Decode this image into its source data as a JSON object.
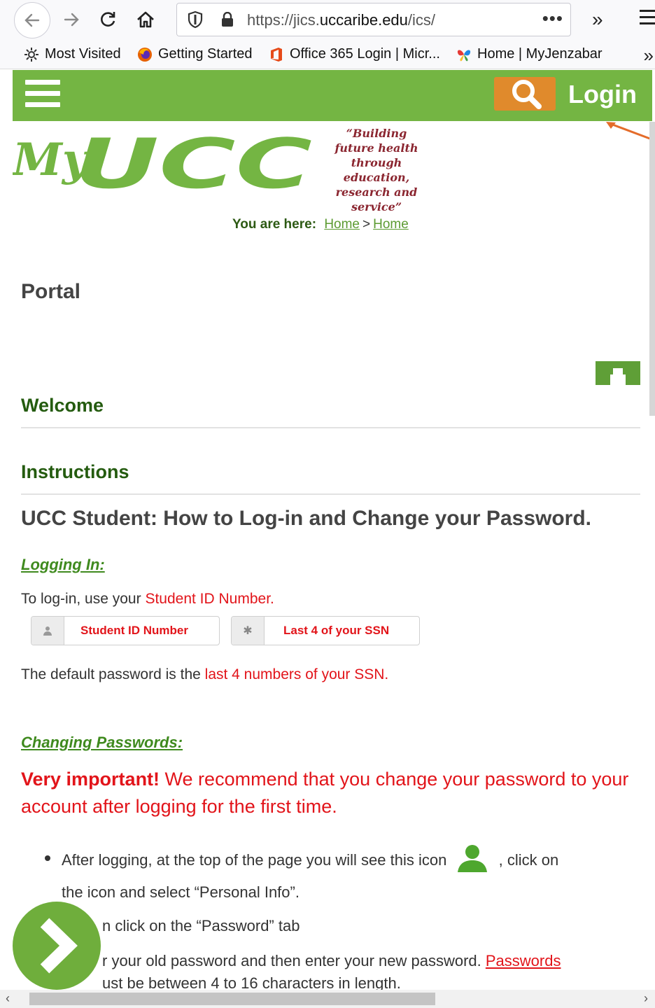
{
  "browser": {
    "url_prefix": "https://jics.",
    "url_domain": "uccaribe.edu",
    "url_suffix": "/ics/",
    "more_label": "•••",
    "overflow_label": "»"
  },
  "bookmarks": [
    {
      "label": "Most Visited",
      "icon": "gear-icon"
    },
    {
      "label": "Getting Started",
      "icon": "firefox-icon"
    },
    {
      "label": "Office 365 Login | Micr...",
      "icon": "office-icon"
    },
    {
      "label": "Home | MyJenzabar",
      "icon": "butterfly-icon"
    }
  ],
  "header": {
    "login_label": "Login",
    "colors": {
      "header_green": "#74b543",
      "search_orange": "#e08a2c"
    }
  },
  "logo": {
    "tagline": "“Building future health through education, research and service”"
  },
  "breadcrumb": {
    "prefix": "You are here:",
    "items": [
      "Home",
      "Home"
    ],
    "separator": ">"
  },
  "page": {
    "portal_title": "Portal",
    "welcome": "Welcome",
    "instructions": "Instructions",
    "heading": "UCC Student: How to Log-in and Change your Password."
  },
  "logging_in": {
    "subhead": "Logging In:",
    "intro": "To log-in, use your ",
    "intro_red": "Student ID Number.",
    "field_user": "Student ID Number",
    "field_pass": "Last 4 of your SSN",
    "default_pw": "The default password is the ",
    "default_pw_red": "last 4 numbers of your SSN."
  },
  "changing": {
    "subhead": "Changing Passwords:",
    "important_bold": "Very important!",
    "important_rest": " We recommend that you change your password to your account after logging for the first time.",
    "bullet1_a": "After logging, at the top of the page you will see this icon",
    "bullet1_b": ", click on",
    "bullet1_c": "the icon and select “Personal Info”.",
    "bullet2": "n click on the “Password” tab",
    "bullet3_a": "r your old password and then enter your new password.",
    "bullet3_link": "Passwords",
    "bullet3_b": "ust be between 4 to 16 characters in length."
  }
}
